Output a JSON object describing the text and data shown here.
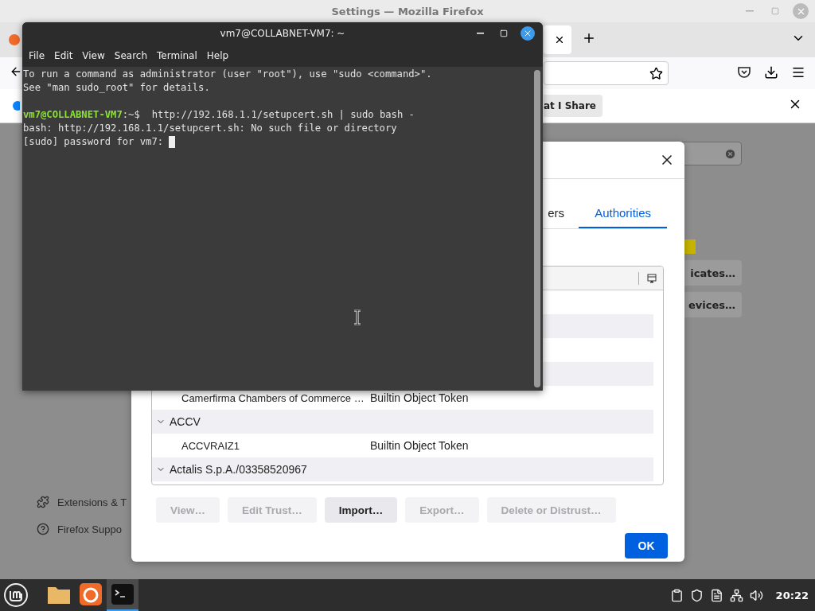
{
  "firefox": {
    "title": "Settings — Mozilla Firefox",
    "notification_button": "at I Share",
    "side_buttons": [
      "icates…",
      "evices…"
    ],
    "sidebar": [
      "Extensions & T",
      "Firefox Suppo"
    ]
  },
  "certificate_dialog": {
    "tabs": [
      {
        "label": "ers",
        "selected": false
      },
      {
        "label": "Authorities",
        "selected": true
      }
    ],
    "rows": [
      {
        "kind": "cert",
        "name": "Camerfirma Chambers of Commerce …",
        "token": "Builtin Object Token"
      },
      {
        "kind": "group",
        "name": "ACCV",
        "expanded": true
      },
      {
        "kind": "cert",
        "name": "ACCVRAIZ1",
        "token": "Builtin Object Token"
      },
      {
        "kind": "group",
        "name": "Actalis S.p.A./03358520967",
        "expanded": true
      }
    ],
    "buttons": [
      {
        "label": "View…",
        "disabled": true
      },
      {
        "label": "Edit Trust…",
        "disabled": true
      },
      {
        "label": "Import…",
        "disabled": false
      },
      {
        "label": "Export…",
        "disabled": true
      },
      {
        "label": "Delete or Distrust…",
        "disabled": true
      }
    ],
    "ok": "OK"
  },
  "terminal": {
    "title": "vm7@COLLABNET-VM7: ~",
    "menu": [
      "File",
      "Edit",
      "View",
      "Search",
      "Terminal",
      "Help"
    ],
    "lines": [
      {
        "kind": "output",
        "text": "To run a command as administrator (user \"root\"), use \"sudo <command>\"."
      },
      {
        "kind": "output",
        "text": "See \"man sudo_root\" for details."
      },
      {
        "kind": "blank"
      },
      {
        "kind": "prompt",
        "user": "vm7@COLLABNET-VM7",
        "path": ":~$",
        "command": "http://192.168.1.1/setupcert.sh | sudo bash -"
      },
      {
        "kind": "output",
        "text": "bash: http://192.168.1.1/setupcert.sh: No such file or directory"
      },
      {
        "kind": "input",
        "text": "[sudo] password for vm7:",
        "cursor": true
      }
    ]
  },
  "taskbar": {
    "apps": [
      {
        "kind": "files",
        "selected": false
      },
      {
        "kind": "firefox",
        "selected": false
      },
      {
        "kind": "terminal",
        "selected": true
      }
    ],
    "clock": "20:22"
  }
}
